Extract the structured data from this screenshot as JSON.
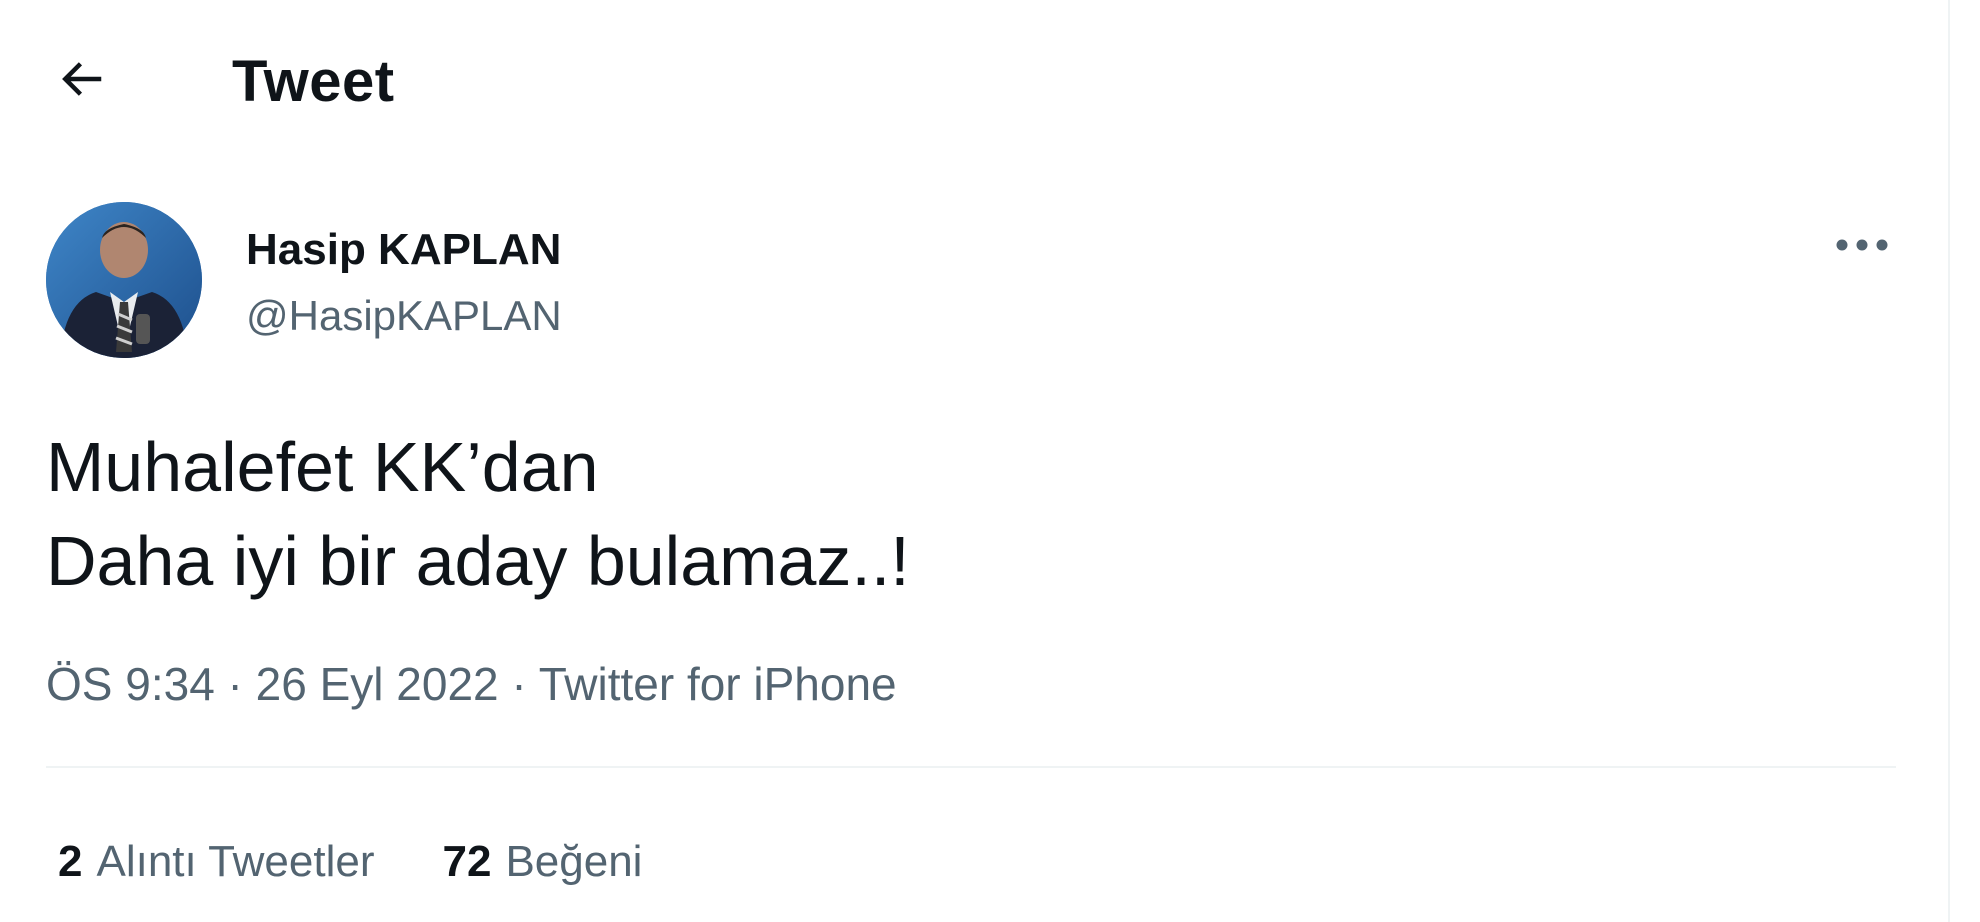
{
  "header": {
    "back_icon": "arrow-left-icon",
    "title": "Tweet"
  },
  "author": {
    "name": "Hasip KAPLAN",
    "handle": "@HasipKAPLAN",
    "more_icon": "more-horizontal-icon"
  },
  "tweet": {
    "lines": [
      "Muhalefet KK’dan",
      "Daha iyi bir aday bulamaz..!"
    ]
  },
  "meta": {
    "time": "ÖS 9:34",
    "separator": " · ",
    "date": "26 Eyl 2022",
    "source": "Twitter for iPhone"
  },
  "stats": [
    {
      "count": "2",
      "label": "Alıntı Tweetler"
    },
    {
      "count": "72",
      "label": "Beğeni"
    }
  ],
  "colors": {
    "text_primary": "#0f1419",
    "text_secondary": "#536471",
    "divider": "#eff3f4",
    "background": "#ffffff"
  }
}
